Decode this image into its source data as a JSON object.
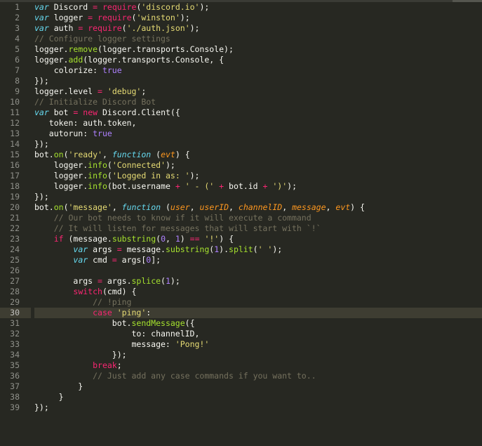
{
  "editor": {
    "active_line": 30,
    "line_numbers": [
      "1",
      "2",
      "3",
      "4",
      "5",
      "6",
      "7",
      "8",
      "9",
      "10",
      "11",
      "12",
      "13",
      "14",
      "15",
      "16",
      "17",
      "18",
      "19",
      "20",
      "21",
      "22",
      "23",
      "24",
      "25",
      "26",
      "27",
      "28",
      "29",
      "30",
      "31",
      "32",
      "33",
      "34",
      "35",
      "36",
      "37",
      "38",
      "39"
    ],
    "lines": [
      [
        {
          "t": "kw",
          "v": "var"
        },
        {
          "t": "p",
          "v": " Discord "
        },
        {
          "t": "op",
          "v": "="
        },
        {
          "t": "p",
          "v": " "
        },
        {
          "t": "op",
          "v": "require"
        },
        {
          "t": "p",
          "v": "("
        },
        {
          "t": "str",
          "v": "'discord.io'"
        },
        {
          "t": "p",
          "v": ");"
        }
      ],
      [
        {
          "t": "kw",
          "v": "var"
        },
        {
          "t": "p",
          "v": " logger "
        },
        {
          "t": "op",
          "v": "="
        },
        {
          "t": "p",
          "v": " "
        },
        {
          "t": "op",
          "v": "require"
        },
        {
          "t": "p",
          "v": "("
        },
        {
          "t": "str",
          "v": "'winston'"
        },
        {
          "t": "p",
          "v": ");"
        }
      ],
      [
        {
          "t": "kw",
          "v": "var"
        },
        {
          "t": "p",
          "v": " auth "
        },
        {
          "t": "op",
          "v": "="
        },
        {
          "t": "p",
          "v": " "
        },
        {
          "t": "op",
          "v": "require"
        },
        {
          "t": "p",
          "v": "("
        },
        {
          "t": "str",
          "v": "'./auth.json'"
        },
        {
          "t": "p",
          "v": ");"
        }
      ],
      [
        {
          "t": "cm",
          "v": "// Configure logger settings"
        }
      ],
      [
        {
          "t": "p",
          "v": "logger."
        },
        {
          "t": "fn",
          "v": "remove"
        },
        {
          "t": "p",
          "v": "(logger.transports.Console);"
        }
      ],
      [
        {
          "t": "p",
          "v": "logger."
        },
        {
          "t": "fn",
          "v": "add"
        },
        {
          "t": "p",
          "v": "(logger.transports.Console, {"
        }
      ],
      [
        {
          "t": "p",
          "v": "    colorize: "
        },
        {
          "t": "bool",
          "v": "true"
        }
      ],
      [
        {
          "t": "p",
          "v": "});"
        }
      ],
      [
        {
          "t": "p",
          "v": "logger.level "
        },
        {
          "t": "op",
          "v": "="
        },
        {
          "t": "p",
          "v": " "
        },
        {
          "t": "str",
          "v": "'debug'"
        },
        {
          "t": "p",
          "v": ";"
        }
      ],
      [
        {
          "t": "cm",
          "v": "// Initialize Discord Bot"
        }
      ],
      [
        {
          "t": "kw",
          "v": "var"
        },
        {
          "t": "p",
          "v": " bot "
        },
        {
          "t": "op",
          "v": "="
        },
        {
          "t": "p",
          "v": " "
        },
        {
          "t": "op",
          "v": "new"
        },
        {
          "t": "p",
          "v": " Discord.Client({"
        }
      ],
      [
        {
          "t": "p",
          "v": "   token: auth.token,"
        }
      ],
      [
        {
          "t": "p",
          "v": "   autorun: "
        },
        {
          "t": "bool",
          "v": "true"
        }
      ],
      [
        {
          "t": "p",
          "v": "});"
        }
      ],
      [
        {
          "t": "p",
          "v": "bot."
        },
        {
          "t": "fn",
          "v": "on"
        },
        {
          "t": "p",
          "v": "("
        },
        {
          "t": "str",
          "v": "'ready'"
        },
        {
          "t": "p",
          "v": ", "
        },
        {
          "t": "kw",
          "v": "function"
        },
        {
          "t": "p",
          "v": " ("
        },
        {
          "t": "par",
          "v": "evt"
        },
        {
          "t": "p",
          "v": ") {"
        }
      ],
      [
        {
          "t": "p",
          "v": "    logger."
        },
        {
          "t": "fn",
          "v": "info"
        },
        {
          "t": "p",
          "v": "("
        },
        {
          "t": "str",
          "v": "'Connected'"
        },
        {
          "t": "p",
          "v": ");"
        }
      ],
      [
        {
          "t": "p",
          "v": "    logger."
        },
        {
          "t": "fn",
          "v": "info"
        },
        {
          "t": "p",
          "v": "("
        },
        {
          "t": "str",
          "v": "'Logged in as: '"
        },
        {
          "t": "p",
          "v": ");"
        }
      ],
      [
        {
          "t": "p",
          "v": "    logger."
        },
        {
          "t": "fn",
          "v": "info"
        },
        {
          "t": "p",
          "v": "(bot.username "
        },
        {
          "t": "op",
          "v": "+"
        },
        {
          "t": "p",
          "v": " "
        },
        {
          "t": "str",
          "v": "' - ('"
        },
        {
          "t": "p",
          "v": " "
        },
        {
          "t": "op",
          "v": "+"
        },
        {
          "t": "p",
          "v": " bot.id "
        },
        {
          "t": "op",
          "v": "+"
        },
        {
          "t": "p",
          "v": " "
        },
        {
          "t": "str",
          "v": "')'"
        },
        {
          "t": "p",
          "v": ");"
        }
      ],
      [
        {
          "t": "p",
          "v": "});"
        }
      ],
      [
        {
          "t": "p",
          "v": "bot."
        },
        {
          "t": "fn",
          "v": "on"
        },
        {
          "t": "p",
          "v": "("
        },
        {
          "t": "str",
          "v": "'message'"
        },
        {
          "t": "p",
          "v": ", "
        },
        {
          "t": "kw",
          "v": "function"
        },
        {
          "t": "p",
          "v": " ("
        },
        {
          "t": "par",
          "v": "user"
        },
        {
          "t": "p",
          "v": ", "
        },
        {
          "t": "par",
          "v": "userID"
        },
        {
          "t": "p",
          "v": ", "
        },
        {
          "t": "par",
          "v": "channelID"
        },
        {
          "t": "p",
          "v": ", "
        },
        {
          "t": "par",
          "v": "message"
        },
        {
          "t": "p",
          "v": ", "
        },
        {
          "t": "par",
          "v": "evt"
        },
        {
          "t": "p",
          "v": ") {"
        }
      ],
      [
        {
          "t": "p",
          "v": "    "
        },
        {
          "t": "cm",
          "v": "// Our bot needs to know if it will execute a command"
        }
      ],
      [
        {
          "t": "p",
          "v": "    "
        },
        {
          "t": "cm",
          "v": "// It will listen for messages that will start with `!`"
        }
      ],
      [
        {
          "t": "p",
          "v": "    "
        },
        {
          "t": "ctrl",
          "v": "if"
        },
        {
          "t": "p",
          "v": " (message."
        },
        {
          "t": "fn",
          "v": "substring"
        },
        {
          "t": "p",
          "v": "("
        },
        {
          "t": "num",
          "v": "0"
        },
        {
          "t": "p",
          "v": ", "
        },
        {
          "t": "num",
          "v": "1"
        },
        {
          "t": "p",
          "v": ") "
        },
        {
          "t": "op",
          "v": "=="
        },
        {
          "t": "p",
          "v": " "
        },
        {
          "t": "str",
          "v": "'!'"
        },
        {
          "t": "p",
          "v": ") {"
        }
      ],
      [
        {
          "t": "p",
          "v": "        "
        },
        {
          "t": "kw",
          "v": "var"
        },
        {
          "t": "p",
          "v": " args "
        },
        {
          "t": "op",
          "v": "="
        },
        {
          "t": "p",
          "v": " message."
        },
        {
          "t": "fn",
          "v": "substring"
        },
        {
          "t": "p",
          "v": "("
        },
        {
          "t": "num",
          "v": "1"
        },
        {
          "t": "p",
          "v": ")."
        },
        {
          "t": "fn",
          "v": "split"
        },
        {
          "t": "p",
          "v": "("
        },
        {
          "t": "str",
          "v": "' '"
        },
        {
          "t": "p",
          "v": ");"
        }
      ],
      [
        {
          "t": "p",
          "v": "        "
        },
        {
          "t": "kw",
          "v": "var"
        },
        {
          "t": "p",
          "v": " cmd "
        },
        {
          "t": "op",
          "v": "="
        },
        {
          "t": "p",
          "v": " args["
        },
        {
          "t": "num",
          "v": "0"
        },
        {
          "t": "p",
          "v": "];"
        }
      ],
      [
        {
          "t": "p",
          "v": ""
        }
      ],
      [
        {
          "t": "p",
          "v": "        args "
        },
        {
          "t": "op",
          "v": "="
        },
        {
          "t": "p",
          "v": " args."
        },
        {
          "t": "fn",
          "v": "splice"
        },
        {
          "t": "p",
          "v": "("
        },
        {
          "t": "num",
          "v": "1"
        },
        {
          "t": "p",
          "v": ");"
        }
      ],
      [
        {
          "t": "p",
          "v": "        "
        },
        {
          "t": "ctrl",
          "v": "switch"
        },
        {
          "t": "p",
          "v": "(cmd) {"
        }
      ],
      [
        {
          "t": "p",
          "v": "            "
        },
        {
          "t": "cm",
          "v": "// !ping"
        }
      ],
      [
        {
          "t": "p",
          "v": "            "
        },
        {
          "t": "ctrl",
          "v": "case"
        },
        {
          "t": "p",
          "v": " "
        },
        {
          "t": "str",
          "v": "'ping'"
        },
        {
          "t": "p",
          "v": ":"
        }
      ],
      [
        {
          "t": "p",
          "v": "                bot."
        },
        {
          "t": "fn",
          "v": "sendMessage"
        },
        {
          "t": "p",
          "v": "({"
        }
      ],
      [
        {
          "t": "p",
          "v": "                    to: channelID,"
        }
      ],
      [
        {
          "t": "p",
          "v": "                    message: "
        },
        {
          "t": "str",
          "v": "'Pong!'"
        }
      ],
      [
        {
          "t": "p",
          "v": "                });"
        }
      ],
      [
        {
          "t": "p",
          "v": "            "
        },
        {
          "t": "ctrl",
          "v": "break"
        },
        {
          "t": "p",
          "v": ";"
        }
      ],
      [
        {
          "t": "p",
          "v": "            "
        },
        {
          "t": "cm",
          "v": "// Just add any case commands if you want to.."
        }
      ],
      [
        {
          "t": "p",
          "v": "         }"
        }
      ],
      [
        {
          "t": "p",
          "v": "     }"
        }
      ],
      [
        {
          "t": "p",
          "v": "});"
        }
      ]
    ]
  }
}
